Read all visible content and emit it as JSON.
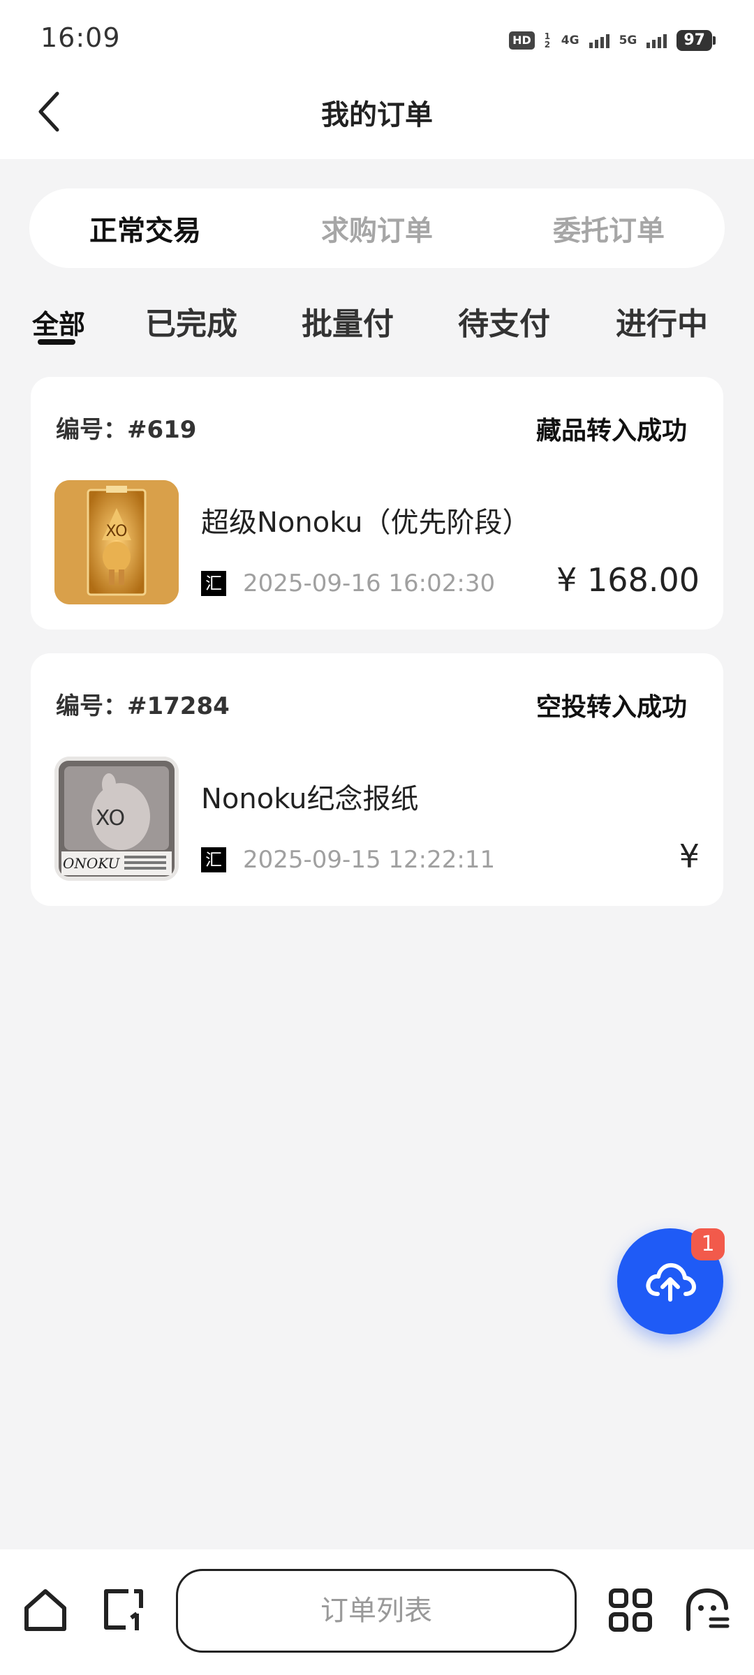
{
  "status_bar": {
    "time": "16:09",
    "hd_label": "HD",
    "hd_sub": "1 2",
    "net1": "4G",
    "net2": "5G",
    "battery": "97"
  },
  "header": {
    "title": "我的订单",
    "back_icon": "chevron-left-icon"
  },
  "segments": [
    {
      "label": "正常交易",
      "active": true
    },
    {
      "label": "求购订单",
      "active": false
    },
    {
      "label": "委托订单",
      "active": false
    }
  ],
  "filters": [
    {
      "label": "全部",
      "active": true
    },
    {
      "label": "已完成",
      "active": false
    },
    {
      "label": "批量付",
      "active": false
    },
    {
      "label": "待支付",
      "active": false
    },
    {
      "label": "进行中",
      "active": false
    }
  ],
  "orders": [
    {
      "number": "编号：#619",
      "status": "藏品转入成功",
      "name": "超级Nonoku（优先阶段）",
      "source_icon": "汇",
      "datetime": "2025-09-16 16:02:30",
      "price": "¥ 168.00"
    },
    {
      "number": "编号：#17284",
      "status": "空投转入成功",
      "name": "Nonoku纪念报纸",
      "source_icon": "汇",
      "datetime": "2025-09-15 12:22:11",
      "price": "¥"
    }
  ],
  "thumb_text": {
    "xo": "XO",
    "brand": "ONOKU"
  },
  "fab": {
    "icon": "cloud-upload-icon",
    "badge": "1",
    "color": "#1f5bf6"
  },
  "bottom_bar": {
    "center_label": "订单列表",
    "icons": [
      "home-icon",
      "add-page-icon",
      "grid-icon",
      "ghost-icon"
    ]
  }
}
